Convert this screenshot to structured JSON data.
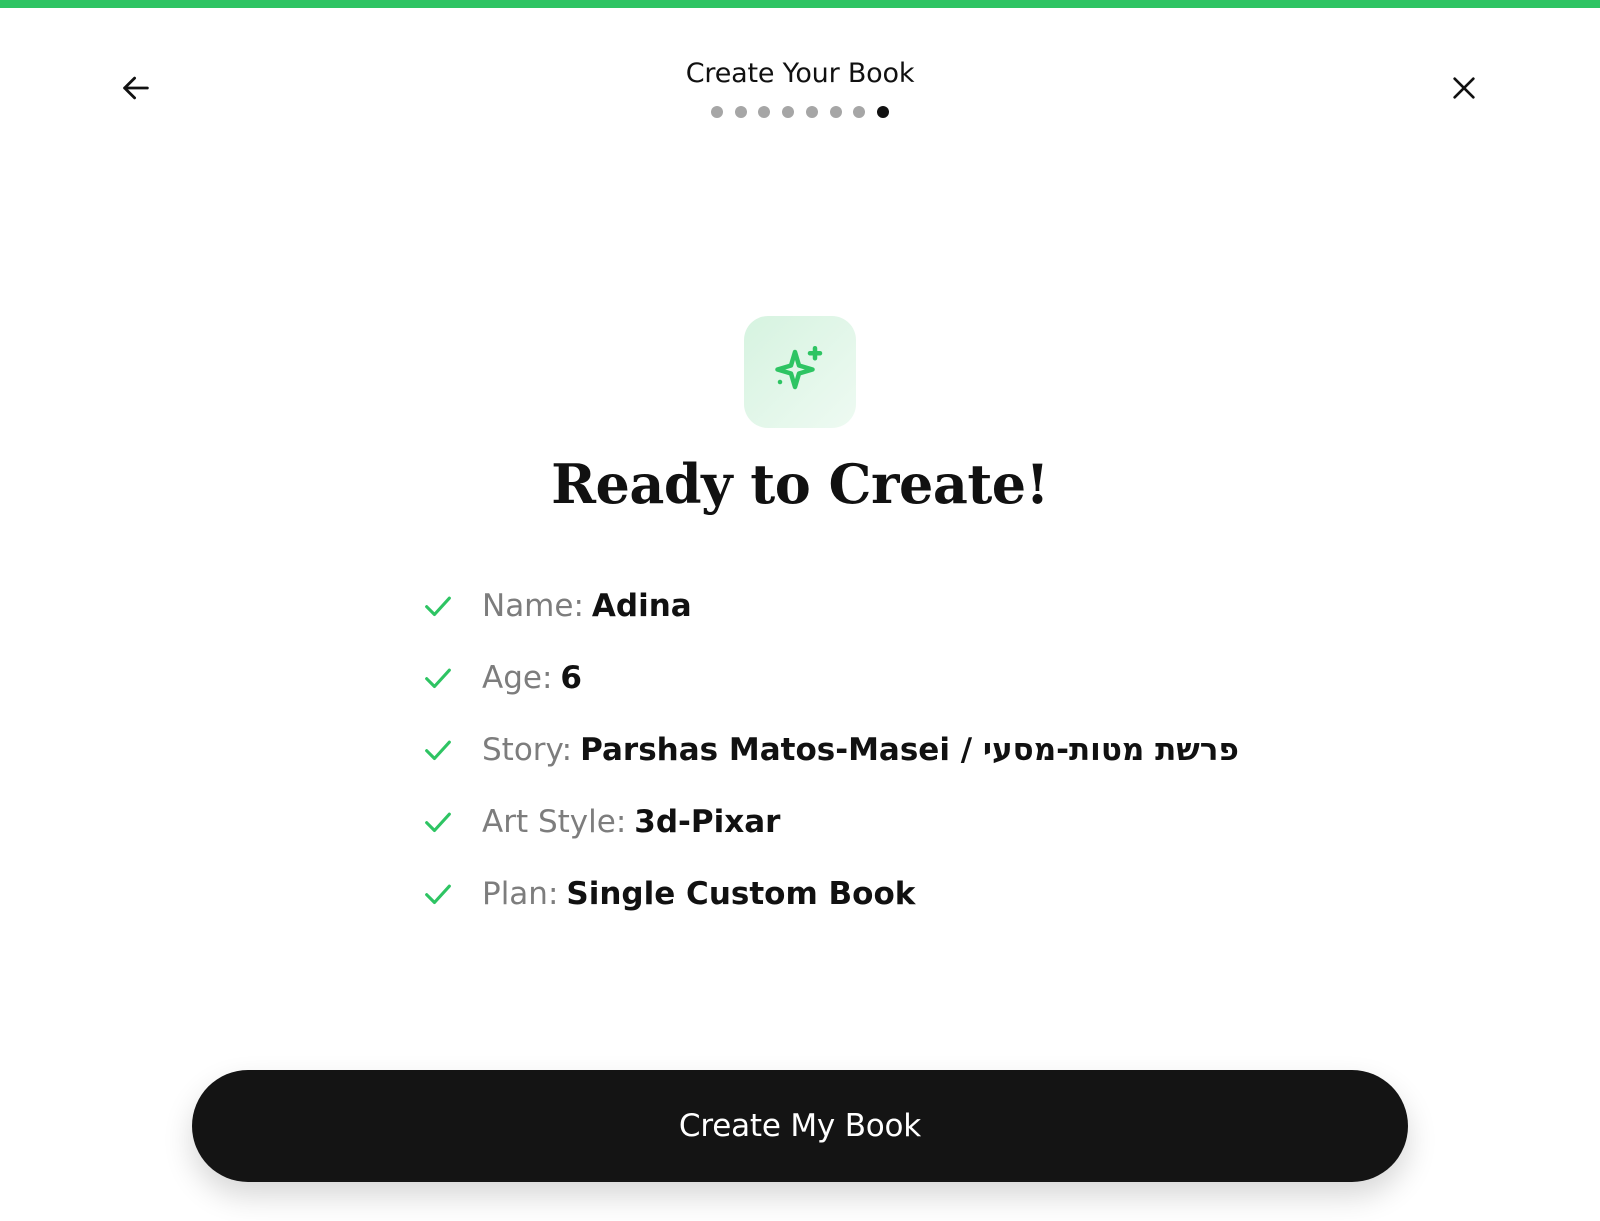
{
  "progress": {
    "fraction": 1.0,
    "color": "#2ec463"
  },
  "header": {
    "title": "Create Your Book",
    "back_icon": "arrow-left-icon",
    "close_icon": "close-icon"
  },
  "steps": {
    "total": 8,
    "current": 8
  },
  "hero": {
    "icon": "sparkle-icon",
    "title": "Ready to Create!"
  },
  "summary": {
    "items": [
      {
        "label": "Name:",
        "value": "Adina"
      },
      {
        "label": "Age:",
        "value": "6"
      },
      {
        "label": "Story:",
        "value": "Parshas Matos-Masei / פרשת מטות-מסעי"
      },
      {
        "label": "Art Style:",
        "value": "3d-Pixar"
      },
      {
        "label": "Plan:",
        "value": "Single Custom Book"
      }
    ],
    "check_icon": "check-icon",
    "check_color": "#2ec463"
  },
  "actions": {
    "create_label": "Create My Book"
  }
}
